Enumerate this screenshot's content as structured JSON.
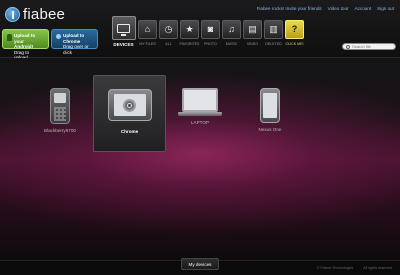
{
  "brand": {
    "name": "fiabee"
  },
  "top_links": {
    "invite": "Fiabee rocks! Invite your friends",
    "video_tour": "Video tour",
    "account": "Account",
    "sign_out": "Sign out"
  },
  "upload": {
    "android": {
      "title": "Upload to your Android!",
      "subtitle": "Drag to upload"
    },
    "chrome": {
      "title": "Upload to Chrome",
      "subtitle": "Drag over or click"
    }
  },
  "nav": {
    "devices": "DEVICES",
    "my_files": "MY FILES",
    "all": "ALL",
    "favorites": "FAVORITES",
    "photo": "PHOTO",
    "music": "MUSIC",
    "video": "VIDEO",
    "deleted": "DELETED",
    "click_me": "CLICK ME!",
    "help_glyph": "?"
  },
  "search": {
    "placeholder": "Search file"
  },
  "devices": [
    {
      "label": "Blackberry9700"
    },
    {
      "label": "Chrome"
    },
    {
      "label": "LAPTOP"
    },
    {
      "label": "Nexus One"
    }
  ],
  "footer": {
    "tab": "My devices",
    "copyright": "© Fiabee Technologies",
    "rights": "All rights reserved"
  },
  "colors": {
    "accent_link": "#8ab8e8",
    "android_green": "#6aa836",
    "chrome_blue": "#1f5686",
    "help_yellow": "#d9c233",
    "stage_magenta": "#8a2460"
  }
}
